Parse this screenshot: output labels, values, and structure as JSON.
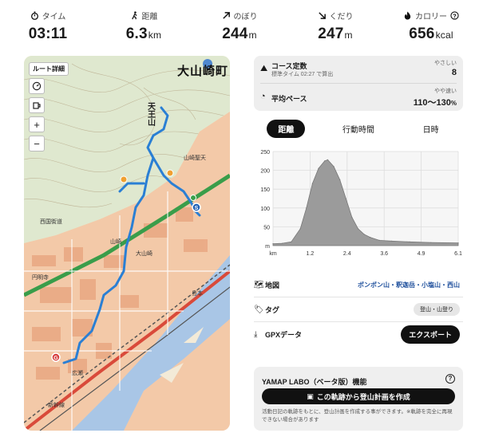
{
  "stats": [
    {
      "label": "タイム",
      "value": "03:11",
      "unit": "",
      "icon": "stopwatch-icon"
    },
    {
      "label": "距離",
      "value": "6.3",
      "unit": "km",
      "icon": "hiker-icon"
    },
    {
      "label": "のぼり",
      "value": "244",
      "unit": "m",
      "icon": "arrow-up-right-icon"
    },
    {
      "label": "くだり",
      "value": "247",
      "unit": "m",
      "icon": "arrow-down-right-icon"
    },
    {
      "label": "カロリー",
      "value": "656",
      "unit": "kcal",
      "icon": "flame-icon"
    }
  ],
  "map": {
    "route_button": "ルート詳細",
    "zoom_in": "+",
    "zoom_out": "−",
    "place_name": "大山崎町",
    "mountain_name": "天王山",
    "labels": [
      "山崎",
      "円明寺",
      "大山崎",
      "広瀬",
      "島本",
      "新幹線",
      "西国街道",
      "山崎聖天"
    ],
    "route_color": "#2a7fd4"
  },
  "info": {
    "course_title": "コース定数",
    "course_sub": "標準タイム 02:27 で算出",
    "course_hint": "やさしい",
    "course_value": "8",
    "pace_title": "平均ペース",
    "pace_hint": "やや速い",
    "pace_value": "110〜130",
    "pace_unit": "%"
  },
  "tabs": [
    "距離",
    "行動時間",
    "日時"
  ],
  "chart_data": {
    "type": "area",
    "xlabel": "km",
    "ylabel": "m",
    "x_ticks": [
      "km",
      "1.2",
      "2.4",
      "3.6",
      "4.9",
      "6.1"
    ],
    "y_ticks": [
      "250",
      "200",
      "150",
      "100",
      "50",
      "m"
    ],
    "ylim": [
      0,
      250
    ],
    "x": [
      0,
      0.3,
      0.6,
      0.9,
      1.1,
      1.3,
      1.5,
      1.7,
      1.8,
      2.0,
      2.2,
      2.4,
      2.6,
      2.8,
      3.0,
      3.2,
      3.5,
      3.9,
      4.5,
      5.2,
      6.1
    ],
    "y": [
      5,
      6,
      10,
      45,
      100,
      165,
      205,
      225,
      228,
      210,
      175,
      125,
      75,
      45,
      30,
      22,
      14,
      12,
      10,
      8,
      7
    ],
    "color": "#9b9b9b"
  },
  "rows": {
    "map_label": "地図",
    "map_value": "ポンポン山・釈迦岳・小塩山・西山",
    "tag_label": "タグ",
    "tag_value": "登山・山登り",
    "gpx_label": "GPXデータ",
    "gpx_button": "エクスポート"
  },
  "labo": {
    "title": "YAMAP LABO（ベータ版）機能",
    "help": "?",
    "button": "この軌跡から登山計画を作成",
    "note": "活動日記の軌跡をもとに、登山計画を作成する事ができます。※軌跡を完全に再現できない場合があります"
  }
}
